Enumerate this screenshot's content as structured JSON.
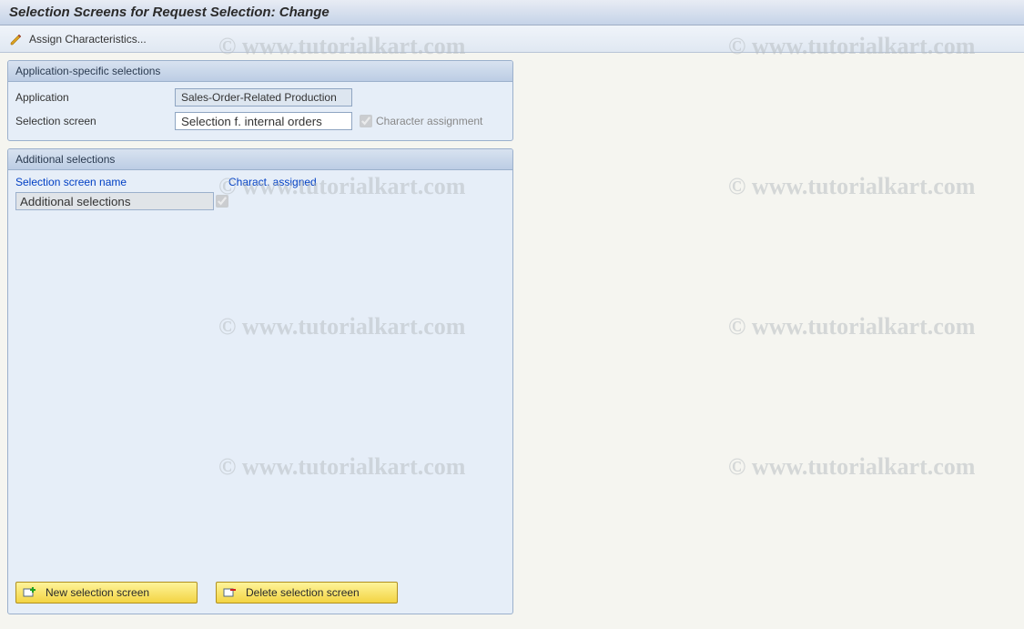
{
  "title": "Selection Screens for Request Selection: Change",
  "toolbar": {
    "assign_characteristics": "Assign Characteristics..."
  },
  "group1": {
    "header": "Application-specific selections",
    "application_label": "Application",
    "application_value": "Sales-Order-Related Production",
    "selection_screen_label": "Selection screen",
    "selection_screen_value": "Selection f. internal orders",
    "character_assignment_label": "Character assignment"
  },
  "group2": {
    "header": "Additional selections",
    "col_selection_screen_name": "Selection screen name",
    "col_charact_assigned": "Charact. assigned",
    "row0": {
      "name": "Additional selections"
    },
    "btn_new": "New selection screen",
    "btn_delete": "Delete selection screen"
  },
  "watermark": "© www.tutorialkart.com"
}
